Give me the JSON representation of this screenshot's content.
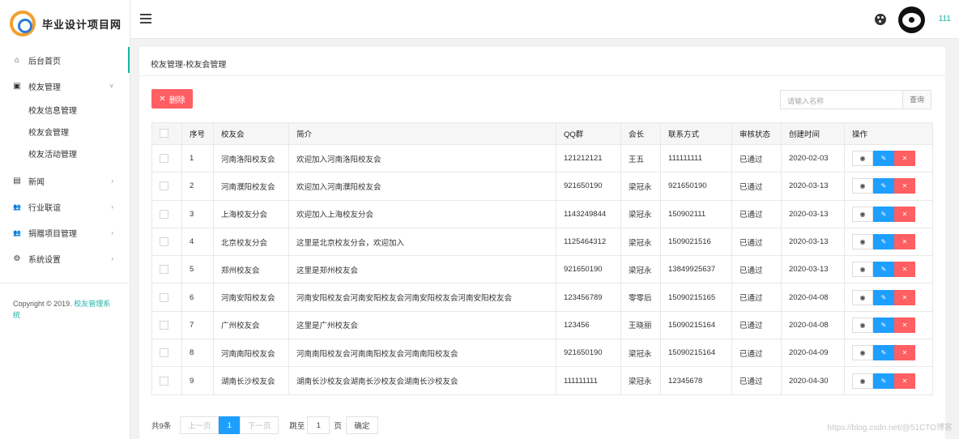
{
  "brand": {
    "title": "毕业设计项目网"
  },
  "sidebar": {
    "items": [
      {
        "label": "后台首页",
        "icon": "home-icon",
        "glyph": "⌂"
      },
      {
        "label": "校友管理",
        "icon": "user-card-icon",
        "glyph": "▣",
        "arrow": "˅"
      },
      {
        "label": "新闻",
        "icon": "news-icon",
        "glyph": "▤",
        "arrow": "›"
      },
      {
        "label": "行业联谊",
        "icon": "group-icon",
        "glyph": "👥",
        "arrow": "›"
      },
      {
        "label": "捐赠项目管理",
        "icon": "donation-icon",
        "glyph": "👥",
        "arrow": "›"
      },
      {
        "label": "系统设置",
        "icon": "gear-icon",
        "glyph": "⚙",
        "arrow": "›"
      }
    ],
    "submenu": [
      "校友信息管理",
      "校友会管理",
      "校友活动管理"
    ],
    "copyright_prefix": "Copyright © 2019.",
    "copyright_brand": "校友管理系统"
  },
  "topbar": {
    "username": "111"
  },
  "main": {
    "breadcrumb": "校友管理-校友会管理",
    "delete_label": "删除",
    "search_placeholder": "请输入名称",
    "search_button": "查询"
  },
  "table": {
    "columns": [
      "序号",
      "校友会",
      "简介",
      "QQ群",
      "会长",
      "联系方式",
      "审核状态",
      "创建时间",
      "操作"
    ],
    "rows": [
      [
        "1",
        "河南洛阳校友会",
        "欢迎加入河南洛阳校友会",
        "121212121",
        "王五",
        "111111111",
        "已通过",
        "2020-02-03"
      ],
      [
        "2",
        "河南濮阳校友会",
        "欢迎加入河南濮阳校友会",
        "921650190",
        "梁冠永",
        "921650190",
        "已通过",
        "2020-03-13"
      ],
      [
        "3",
        "上海校友分会",
        "欢迎加入上海校友分会",
        "1143249844",
        "梁冠永",
        "150902111",
        "已通过",
        "2020-03-13"
      ],
      [
        "4",
        "北京校友分会",
        "这里是北京校友分会，欢迎加入",
        "1125464312",
        "梁冠永",
        "1509021516",
        "已通过",
        "2020-03-13"
      ],
      [
        "5",
        "郑州校友会",
        "这里是郑州校友会",
        "921650190",
        "梁冠永",
        "13849925637",
        "已通过",
        "2020-03-13"
      ],
      [
        "6",
        "河南安阳校友会",
        "河南安阳校友会河南安阳校友会河南安阳校友会河南安阳校友会",
        "123456789",
        "零零后",
        "15090215165",
        "已通过",
        "2020-04-08"
      ],
      [
        "7",
        "广州校友会",
        "这里是广州校友会",
        "123456",
        "王晓丽",
        "15090215164",
        "已通过",
        "2020-04-08"
      ],
      [
        "8",
        "河南南阳校友会",
        "河南南阳校友会河南南阳校友会河南南阳校友会",
        "921650190",
        "梁冠永",
        "15090215164",
        "已通过",
        "2020-04-09"
      ],
      [
        "9",
        "湖南长沙校友会",
        "湖南长沙校友会湖南长沙校友会湖南长沙校友会",
        "111111111",
        "梁冠永",
        "12345678",
        "已通过",
        "2020-04-30"
      ]
    ]
  },
  "pager": {
    "total": "共9条",
    "prev": "上一页",
    "current": "1",
    "next": "下一页",
    "skip": "跳至",
    "input_value": "1",
    "unit": "页",
    "confirm": "确定"
  },
  "watermark": "https://blog.csdn.net/@51CTO博客",
  "colors": {
    "accent": "#19b5a6",
    "primary": "#1e9fff",
    "danger": "#ff5e62"
  }
}
